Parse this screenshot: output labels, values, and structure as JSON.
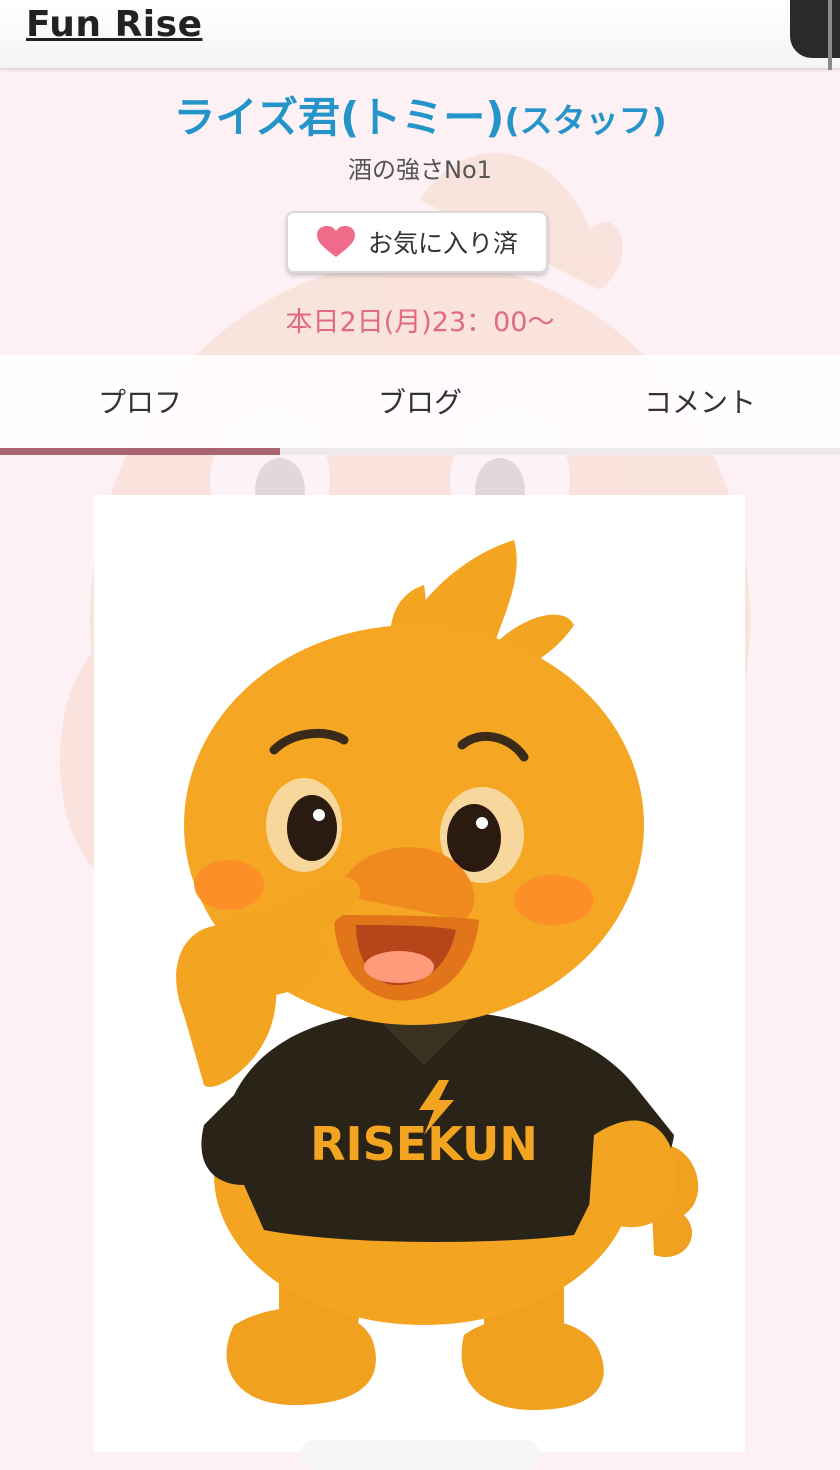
{
  "header": {
    "brand": "Fun Rise"
  },
  "profile": {
    "name": "ライズ君(トミー)",
    "role": "(スタッフ)",
    "catchphrase": "酒の強さNo1",
    "favorite_button_label": "お気に入り済",
    "schedule": "本日2日(月)23：00〜"
  },
  "tabs": [
    {
      "label": "プロフ",
      "active": true
    },
    {
      "label": "ブログ",
      "active": false
    },
    {
      "label": "コメント",
      "active": false
    }
  ],
  "photo": {
    "shirt_text": "RISEKUN"
  },
  "colors": {
    "title": "#2595c9",
    "schedule": "#e06a7e",
    "heart": "#ef6b8a",
    "tab_indicator": "#a86470",
    "mascot": "#f4a324"
  }
}
